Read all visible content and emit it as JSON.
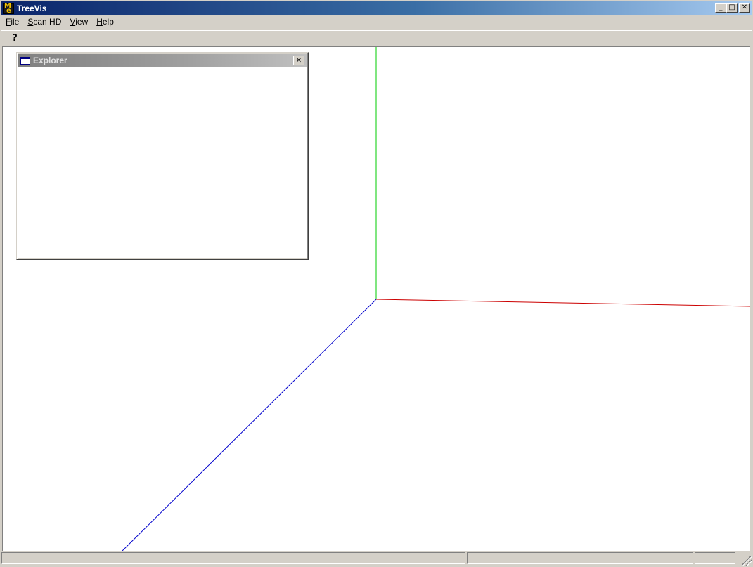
{
  "window": {
    "title": "TreeVis",
    "minimize_glyph": "_",
    "maximize_glyph": "□",
    "close_glyph": "✕"
  },
  "menu": {
    "items": [
      {
        "label": "File",
        "mnemonic": "F",
        "rest": "ile"
      },
      {
        "label": "Scan HD",
        "mnemonic": "S",
        "rest": "can HD"
      },
      {
        "label": "View",
        "mnemonic": "V",
        "rest": "iew"
      },
      {
        "label": "Help",
        "mnemonic": "H",
        "rest": "elp"
      }
    ]
  },
  "toolbar": {
    "help_glyph": "?",
    "help_icon": "help-question-icon"
  },
  "explorer": {
    "title": "Explorer",
    "close_glyph": "✕"
  },
  "axes": {
    "x_color": "#cc0000",
    "y_color": "#00cc00",
    "z_color": "#0000cc"
  },
  "statusbar": {
    "panes": [
      "",
      "",
      "",
      ""
    ]
  }
}
